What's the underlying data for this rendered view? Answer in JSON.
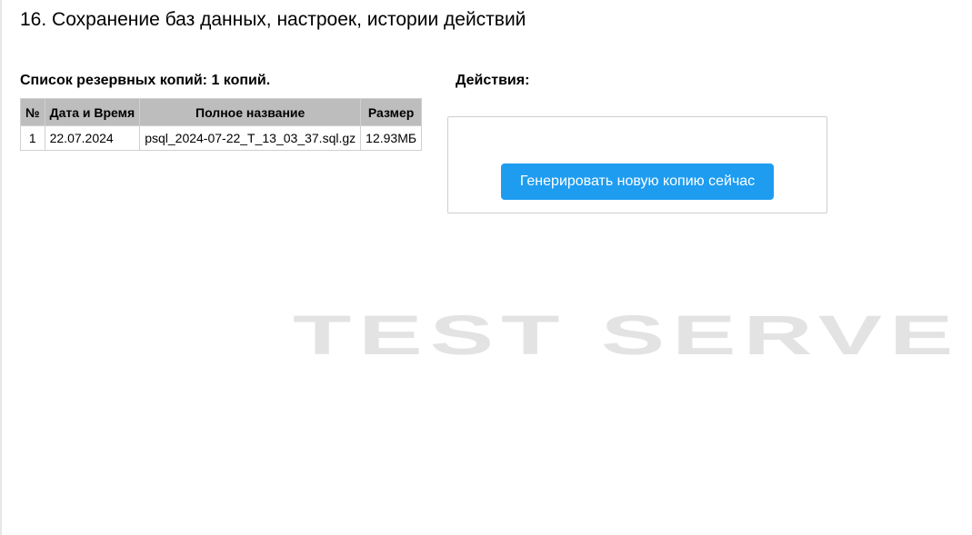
{
  "page": {
    "title": "16. Сохранение баз данных, настроек, истории действий"
  },
  "backups": {
    "heading": "Список резервных копий: 1 копий.",
    "columns": [
      "№",
      "Дата и Время",
      "Полное название",
      "Размер"
    ],
    "rows": [
      {
        "num": "1",
        "datetime": "22.07.2024",
        "name": "psql_2024-07-22_T_13_03_37.sql.gz",
        "size": "12.93МБ"
      }
    ]
  },
  "actions": {
    "heading": "Действия:",
    "generate_label": "Генерировать новую копию сейчас"
  },
  "watermark": {
    "text": "TEST SERVE"
  },
  "colors": {
    "accent": "#1e9cf0",
    "table_header_bg": "#bdbdbd",
    "watermark": "#e3e3e3"
  }
}
